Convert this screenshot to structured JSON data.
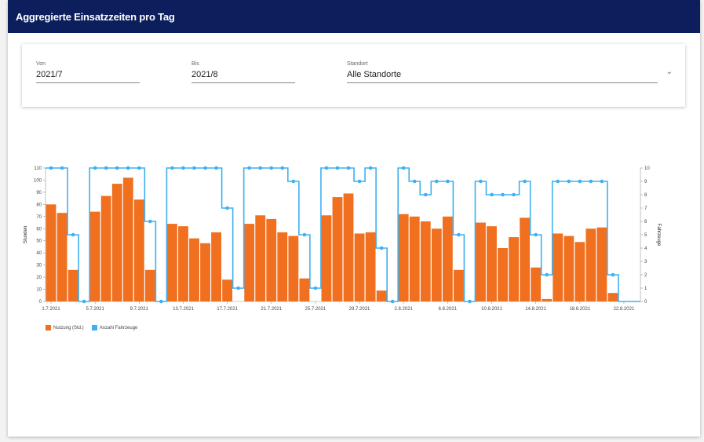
{
  "header": {
    "title": "Aggregierte Einsatzzeiten pro Tag"
  },
  "filters": {
    "von": {
      "label": "Von",
      "value": "2021/7"
    },
    "bis": {
      "label": "Bis",
      "value": "2021/8"
    },
    "standort": {
      "label": "Standort",
      "value": "Alle Standorte"
    }
  },
  "colors": {
    "header": "#0c1f5c",
    "bars": "#f07020",
    "line": "#3fb0f0"
  },
  "chart_data": {
    "type": "bar",
    "x": [
      "1.7.2021",
      "2.7.2021",
      "3.7.2021",
      "4.7.2021",
      "5.7.2021",
      "6.7.2021",
      "7.7.2021",
      "8.7.2021",
      "9.7.2021",
      "10.7.2021",
      "11.7.2021",
      "12.7.2021",
      "13.7.2021",
      "14.7.2021",
      "15.7.2021",
      "16.7.2021",
      "17.7.2021",
      "18.7.2021",
      "19.7.2021",
      "20.7.2021",
      "21.7.2021",
      "22.7.2021",
      "23.7.2021",
      "24.7.2021",
      "25.7.2021",
      "26.7.2021",
      "27.7.2021",
      "28.7.2021",
      "29.7.2021",
      "30.7.2021",
      "31.7.2021",
      "1.8.2021",
      "2.8.2021",
      "3.8.2021",
      "4.8.2021",
      "5.8.2021",
      "6.8.2021",
      "7.8.2021",
      "8.8.2021",
      "9.8.2021",
      "10.8.2021",
      "11.8.2021",
      "12.8.2021",
      "13.8.2021",
      "14.8.2021",
      "15.8.2021",
      "16.8.2021",
      "17.8.2021",
      "18.8.2021",
      "19.8.2021",
      "20.8.2021",
      "21.8.2021",
      "22.8.2021",
      "23.8.2021"
    ],
    "tick_labels": [
      "1.7.2021",
      "5.7.2021",
      "9.7.2021",
      "13.7.2021",
      "17.7.2021",
      "21.7.2021",
      "25.7.2021",
      "29.7.2021",
      "2.8.2021",
      "6.8.2021",
      "10.8.2021",
      "14.8.2021",
      "18.8.2021",
      "22.8.2021"
    ],
    "series": [
      {
        "name": "Nutzung (Std.)",
        "type": "bar",
        "axis": "left",
        "values": [
          80,
          73,
          26,
          0,
          74,
          87,
          97,
          102,
          84,
          26,
          0,
          64,
          62,
          52,
          48,
          57,
          18,
          0,
          64,
          71,
          68,
          57,
          54,
          19,
          0,
          71,
          86,
          89,
          56,
          57,
          9,
          0,
          72,
          70,
          66,
          60,
          70,
          26,
          0,
          65,
          62,
          44,
          53,
          69,
          28,
          2,
          56,
          54,
          49,
          60,
          61,
          7,
          0,
          0
        ]
      },
      {
        "name": "Anzahl Fahrzeuge",
        "type": "line",
        "axis": "right",
        "values": [
          10,
          10,
          5,
          0,
          10,
          10,
          10,
          10,
          10,
          6,
          0,
          10,
          10,
          10,
          10,
          10,
          7,
          1,
          10,
          10,
          10,
          10,
          9,
          5,
          1,
          10,
          10,
          10,
          9,
          10,
          4,
          0,
          10,
          9,
          8,
          9,
          9,
          5,
          0,
          9,
          8,
          8,
          8,
          9,
          5,
          2,
          9,
          9,
          9,
          9,
          9,
          2,
          0,
          0
        ]
      }
    ],
    "ylabel_left": "Stunden",
    "ylabel_right": "Fahrzeuge",
    "ylim_left": [
      0,
      110
    ],
    "ylim_right": [
      0,
      10
    ],
    "yticks_left": [
      0,
      10,
      20,
      30,
      40,
      50,
      60,
      70,
      80,
      90,
      100,
      110
    ],
    "yticks_right": [
      0,
      1,
      2,
      3,
      4,
      5,
      6,
      7,
      8,
      9,
      10
    ],
    "legend_position": "bottom-left",
    "grid": false
  }
}
